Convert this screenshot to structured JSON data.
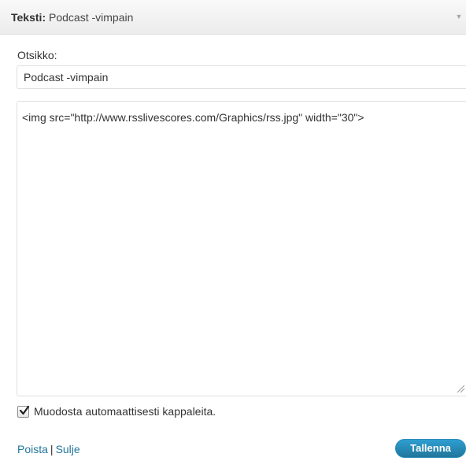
{
  "widget": {
    "title_label": "Teksti",
    "title_separator": ":",
    "title_name": " Podcast -vimpain",
    "toggle_icon": "triangle-down-icon"
  },
  "form": {
    "title_field_label": "Otsikko:",
    "title_value": "Podcast -vimpain",
    "text_value": "<img src=\"http://www.rsslivescores.com/Graphics/rss.jpg\" width=\"30\">",
    "auto_paragraph_label": "Muodosta automaattisesti kappaleita.",
    "auto_paragraph_checked": true
  },
  "footer": {
    "delete_link": "Poista",
    "separator": "|",
    "close_link": "Sulje",
    "save_button": "Tallenna"
  },
  "colors": {
    "link": "#21759b",
    "primary_button": "#21759b",
    "header_bg": "#ececec"
  }
}
